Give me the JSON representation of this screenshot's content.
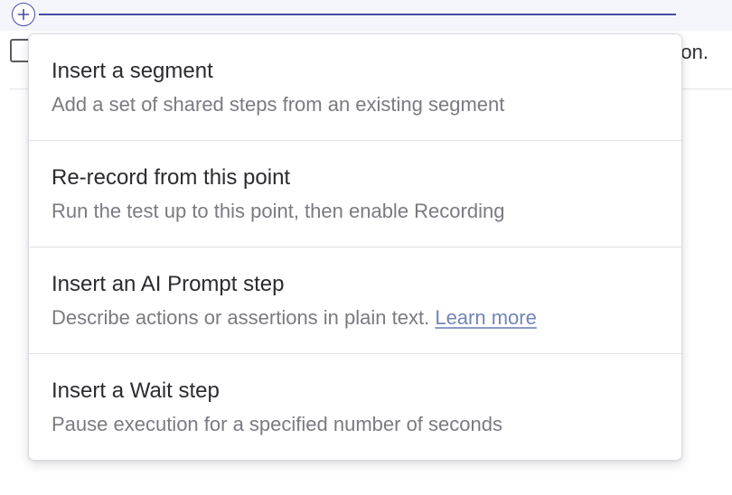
{
  "background": {
    "row_text_fragment": "on."
  },
  "insert_menu": {
    "items": [
      {
        "title": "Insert a segment",
        "description": "Add a set of shared steps from an existing segment"
      },
      {
        "title": "Re-record from this point",
        "description": "Run the test up to this point, then enable Recording"
      },
      {
        "title": "Insert an AI Prompt step",
        "description": "Describe actions or assertions in plain text.",
        "link_label": "Learn more"
      },
      {
        "title": "Insert a Wait step",
        "description": "Pause execution for a specified number of seconds"
      }
    ]
  },
  "colors": {
    "accent": "#4a4aa8",
    "link": "#7285b8",
    "title_text": "#2b2b30",
    "description_text": "#7a7a82"
  },
  "icons": {
    "add_step": "plus-circle-icon"
  }
}
